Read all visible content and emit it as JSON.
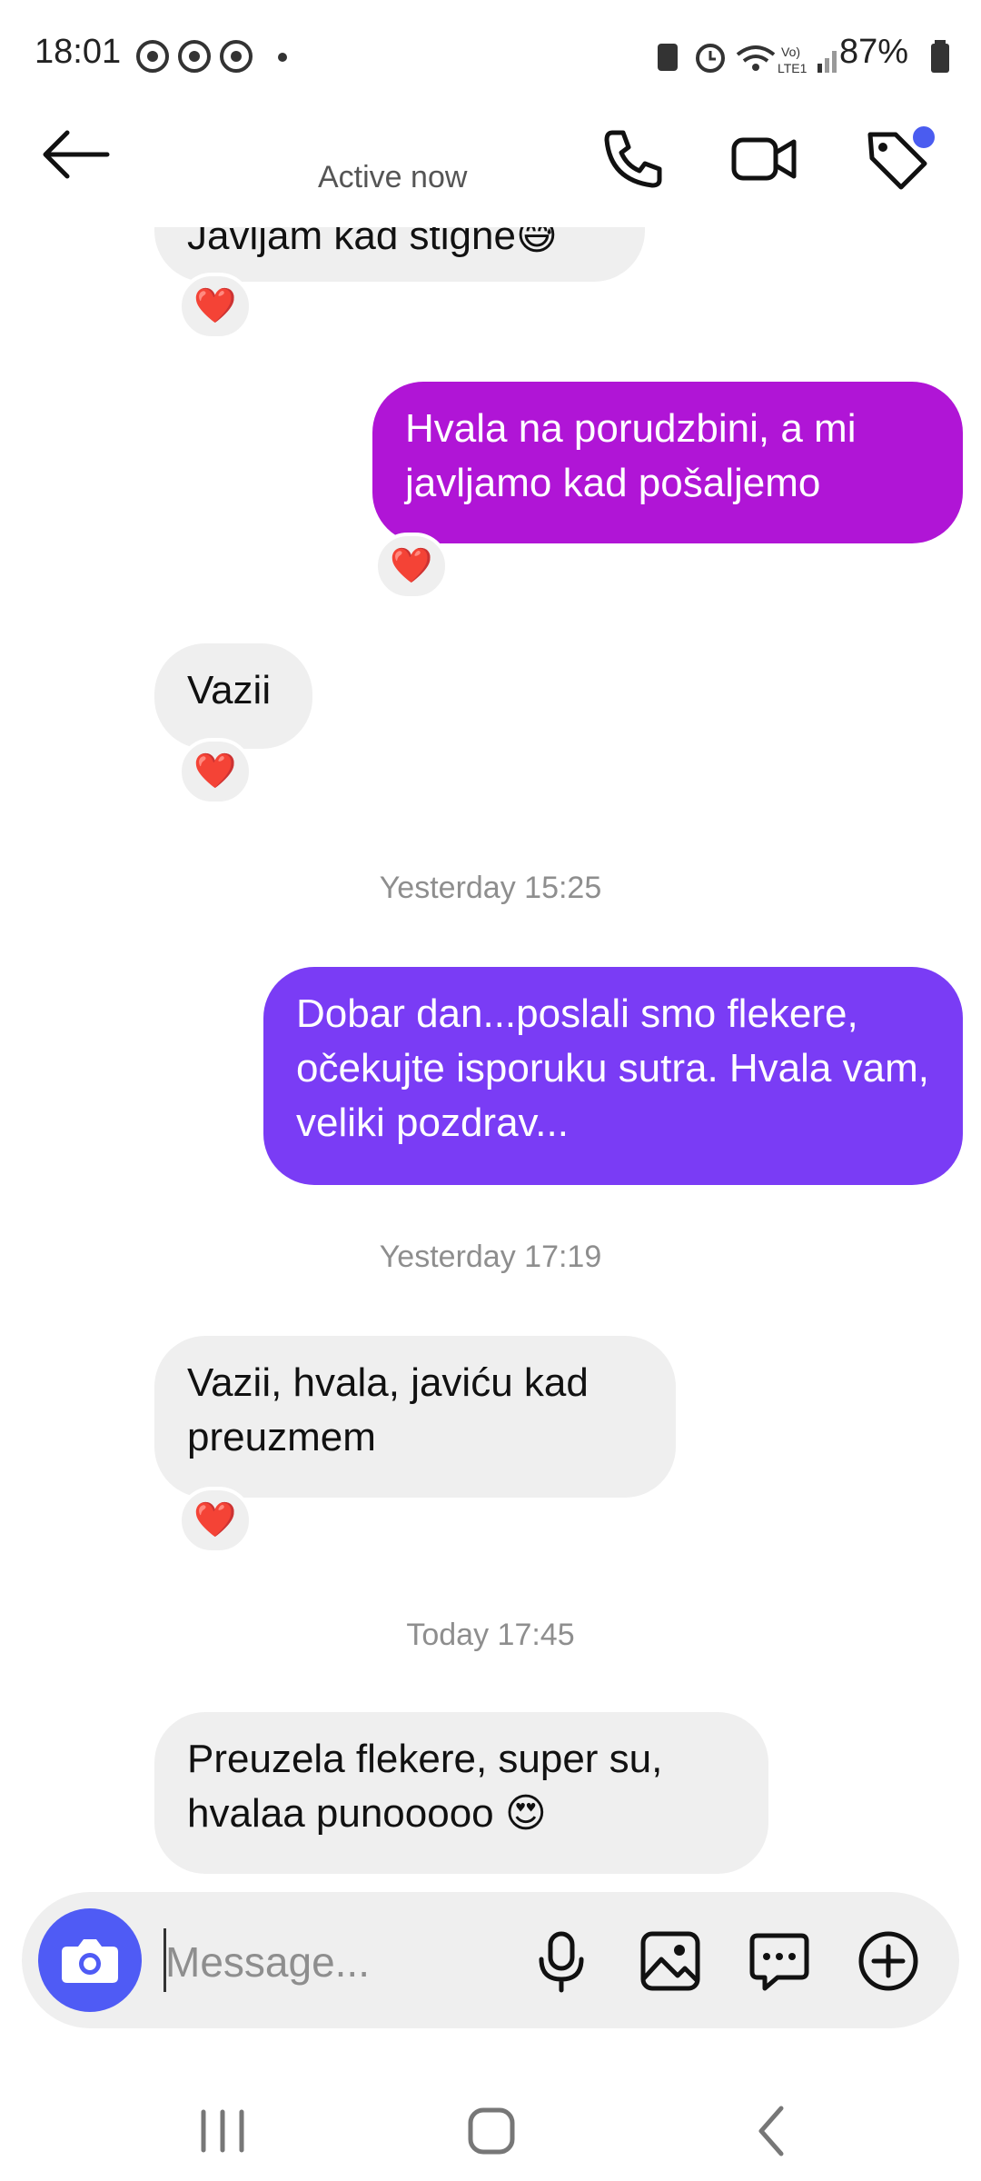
{
  "status_bar": {
    "time": "18:01",
    "battery": "87%"
  },
  "header": {
    "subtitle": "Active now"
  },
  "messages": [
    {
      "type": "incoming-partial",
      "text": "Javljam kad stigne😅",
      "reaction": "❤️"
    },
    {
      "type": "outgoing",
      "text": "Hvala na porudzbini,  a mi javljamo kad pošaljemo",
      "reaction": "❤️"
    },
    {
      "type": "incoming",
      "text": "Vazii",
      "reaction": "❤️"
    },
    {
      "type": "timestamp",
      "text": "Yesterday 15:25"
    },
    {
      "type": "outgoing",
      "text": "Dobar dan...poslali smo flekere, očekujte isporuku sutra. Hvala vam, veliki pozdrav..."
    },
    {
      "type": "timestamp",
      "text": "Yesterday 17:19"
    },
    {
      "type": "incoming",
      "text": "Vazii, hvala, javiću kad preuzmem",
      "reaction": "❤️"
    },
    {
      "type": "timestamp",
      "text": "Today 17:45"
    },
    {
      "type": "incoming",
      "text": "Preuzela flekere, super su, hvalaa punooooo 😍"
    }
  ],
  "composer": {
    "placeholder": "Message..."
  },
  "colors": {
    "bubble_out_1": "#b015d6",
    "bubble_out_2": "#7a3cf5",
    "bubble_in": "#efefef",
    "camera_button": "#4f5bf5",
    "notification_dot": "#4a5cf0"
  },
  "icons": [
    "back-arrow-icon",
    "phone-icon",
    "video-camera-icon",
    "tag-icon",
    "camera-icon",
    "microphone-icon",
    "image-icon",
    "sticker-icon",
    "plus-icon",
    "recent-apps-icon",
    "home-icon",
    "back-nav-icon"
  ]
}
